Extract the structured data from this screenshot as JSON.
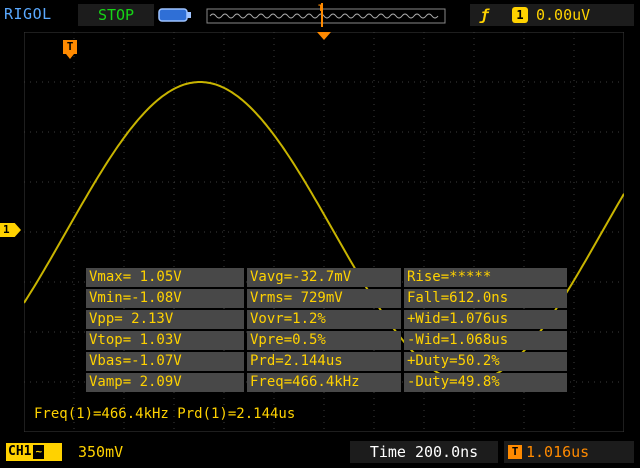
{
  "header": {
    "brand": "RIGOL",
    "run_state": "STOP",
    "trigger": {
      "edge_icon": "rising-edge-icon",
      "source": "1",
      "level": "0.00uV"
    }
  },
  "markers": {
    "trigger_position": "T",
    "channel": "1"
  },
  "measurements": [
    [
      "Vmax= 1.05V",
      "Vavg=-32.7mV",
      "Rise=*****"
    ],
    [
      "Vmin=-1.08V",
      "Vrms= 729mV",
      "Fall=612.0ns"
    ],
    [
      "Vpp= 2.13V",
      "Vovr=1.2%",
      "+Wid=1.076us"
    ],
    [
      "Vtop= 1.03V",
      "Vpre=0.5%",
      "-Wid=1.068us"
    ],
    [
      "Vbas=-1.07V",
      "Prd=2.144us",
      "+Duty=50.2%"
    ],
    [
      "Vamp= 2.09V",
      "Freq=466.4kHz",
      "-Duty=49.8%"
    ]
  ],
  "freq_line": "Freq(1)=466.4kHz Prd(1)=2.144us",
  "footer": {
    "channel": "CH1",
    "coupling": "~",
    "volts_per_div": "350mV",
    "timebase": "Time 200.0ns",
    "delay_icon": "T",
    "delay": "1.016us"
  },
  "colors": {
    "background": "#000000",
    "grid": "#3c3c3c",
    "trace": "#c8b400",
    "channel1": "#ffd200",
    "trigger": "#ff8a00",
    "brand": "#5aa9ff",
    "run_state": "#16d616"
  }
}
